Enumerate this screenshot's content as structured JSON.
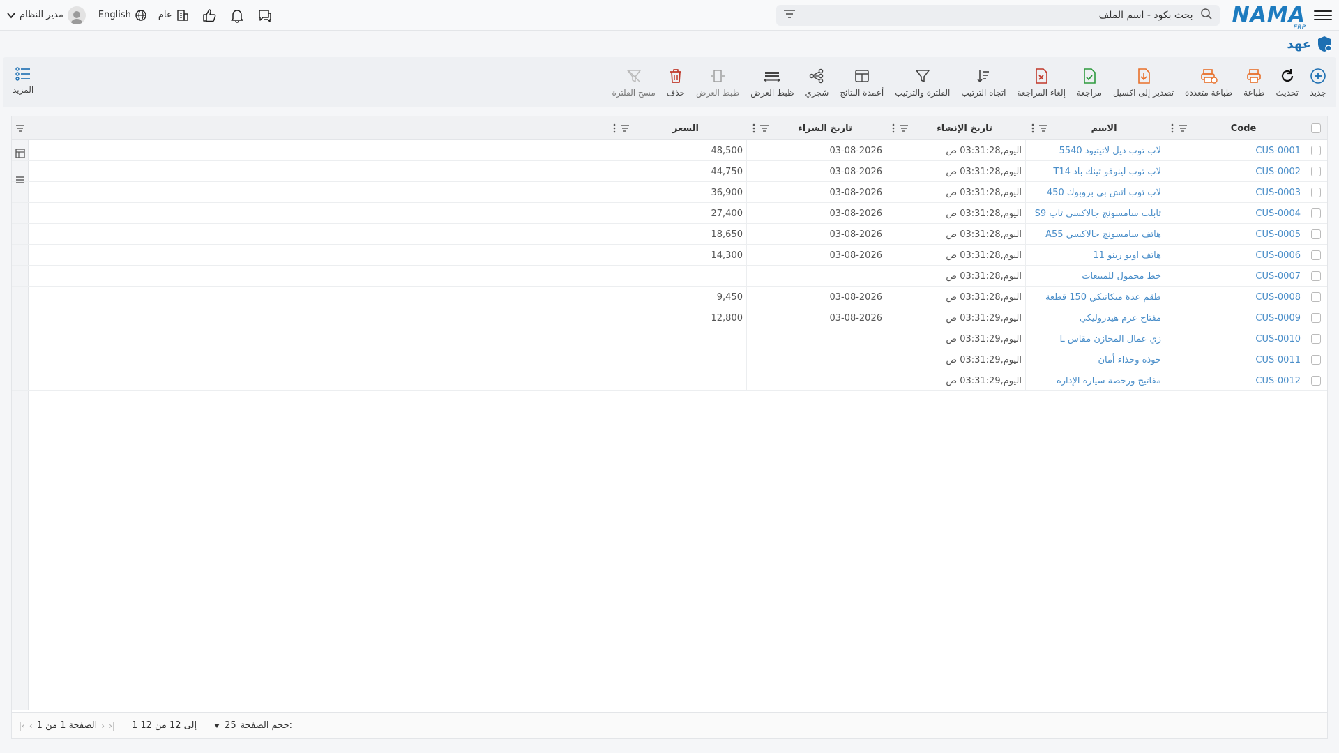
{
  "app": {
    "logo": "NAMA",
    "logo_sub": "ERP",
    "search_placeholder": "بحث بكود - اسم الملف",
    "lang": "English",
    "scope": "عام",
    "user": "مدير النظام"
  },
  "page": {
    "title": "عهد"
  },
  "toolbar": {
    "new": "جديد",
    "refresh": "تحديث",
    "print": "طباعة",
    "multi_print": "طباعة متعددة",
    "export_excel": "تصدير إلى اكسيل",
    "review": "مراجعة",
    "cancel_review": "إلغاء المراجعة",
    "sort_direction": "اتجاه الترتيب",
    "filter_sort": "الفلترة والترتيب",
    "result_columns": "أعمدة النتائج",
    "tree": "شجري",
    "fit_view_1": "ظبط العرض",
    "fit_view_2": "ظبط العرض",
    "delete": "حذف",
    "clear_filter": "مسح الفلترة",
    "more": "المزيد"
  },
  "grid": {
    "columns": {
      "code": "Code",
      "name": "الاسم",
      "created": "تاريخ الإنشاء",
      "purchase_date": "تاريخ الشراء",
      "price": "السعر"
    },
    "rows": [
      {
        "code": "CUS-0001",
        "name": "لاب توب ديل لاتيتيود 5540",
        "created": "اليوم,03:31:28 ص",
        "purchase": "03-08-2026",
        "price": "48,500"
      },
      {
        "code": "CUS-0002",
        "name": "لاب توب لينوفو ثينك باد T14",
        "created": "اليوم,03:31:28 ص",
        "purchase": "03-08-2026",
        "price": "44,750"
      },
      {
        "code": "CUS-0003",
        "name": "لاب توب اتش بي بروبوك 450",
        "created": "اليوم,03:31:28 ص",
        "purchase": "03-08-2026",
        "price": "36,900"
      },
      {
        "code": "CUS-0004",
        "name": "تابلت سامسونج جالاكسي تاب S9",
        "created": "اليوم,03:31:28 ص",
        "purchase": "03-08-2026",
        "price": "27,400"
      },
      {
        "code": "CUS-0005",
        "name": "هاتف سامسونج جالاكسي A55",
        "created": "اليوم,03:31:28 ص",
        "purchase": "03-08-2026",
        "price": "18,650"
      },
      {
        "code": "CUS-0006",
        "name": "هاتف اوبو رينو 11",
        "created": "اليوم,03:31:28 ص",
        "purchase": "03-08-2026",
        "price": "14,300"
      },
      {
        "code": "CUS-0007",
        "name": "خط محمول للمبيعات",
        "created": "اليوم,03:31:28 ص",
        "purchase": "",
        "price": ""
      },
      {
        "code": "CUS-0008",
        "name": "طقم عدة ميكانيكي 150 قطعة",
        "created": "اليوم,03:31:28 ص",
        "purchase": "03-08-2026",
        "price": "9,450"
      },
      {
        "code": "CUS-0009",
        "name": "مفتاح عزم هيدروليكي",
        "created": "اليوم,03:31:29 ص",
        "purchase": "03-08-2026",
        "price": "12,800"
      },
      {
        "code": "CUS-0010",
        "name": "زي عمال المخازن مقاس L",
        "created": "اليوم,03:31:29 ص",
        "purchase": "",
        "price": ""
      },
      {
        "code": "CUS-0011",
        "name": "خوذة وحذاء أمان",
        "created": "اليوم,03:31:29 ص",
        "purchase": "",
        "price": ""
      },
      {
        "code": "CUS-0012",
        "name": "مفاتيح ورخصة سيارة الإدارة",
        "created": "اليوم,03:31:29 ص",
        "purchase": "",
        "price": ""
      }
    ]
  },
  "footer": {
    "page_size_label": "حجم الصفحة:",
    "page_size": "25",
    "range": "1 إلى 12 من 12",
    "page_label": "الصفحة 1 من 1"
  }
}
